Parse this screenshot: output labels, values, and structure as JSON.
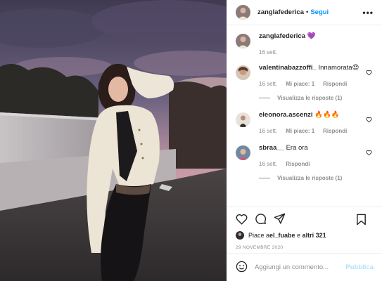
{
  "header": {
    "username": "zanglafederica",
    "separator": "•",
    "follow_label": "Segui",
    "more_label": "•••"
  },
  "caption": {
    "username": "zanglafederica",
    "text": "💜",
    "time": "16 sett."
  },
  "comments": [
    {
      "username": "valentinabazzoffi_",
      "text": "Innamorata😍",
      "time": "16 sett.",
      "likes_label": "Mi piace: 1",
      "reply_label": "Rispondi",
      "replies_label": "Visualizza le risposte (1)"
    },
    {
      "username": "eleonora.ascenzi",
      "text": "🔥🔥🔥",
      "time": "16 sett.",
      "likes_label": "Mi piace: 1",
      "reply_label": "Rispondi"
    },
    {
      "username": "sbraa__",
      "text": "Era ora",
      "time": "16 sett.",
      "reply_label": "Rispondi",
      "replies_label": "Visualizza le risposte (1)"
    }
  ],
  "likes": {
    "prefix": "Piace a ",
    "user": "el_fuabe",
    "middle": " e ",
    "others": "altri 321"
  },
  "post_date": "29 NOVEMBRE 2020",
  "add_comment": {
    "placeholder": "Aggiungi un commento...",
    "publish_label": "Pubblica"
  },
  "colors": {
    "accent": "#0095f6",
    "publish_disabled": "#b2dffc",
    "muted": "#8e8e8e"
  },
  "icons": [
    "heart-icon",
    "comment-icon",
    "share-icon",
    "bookmark-icon",
    "emoji-icon",
    "more-icon"
  ]
}
